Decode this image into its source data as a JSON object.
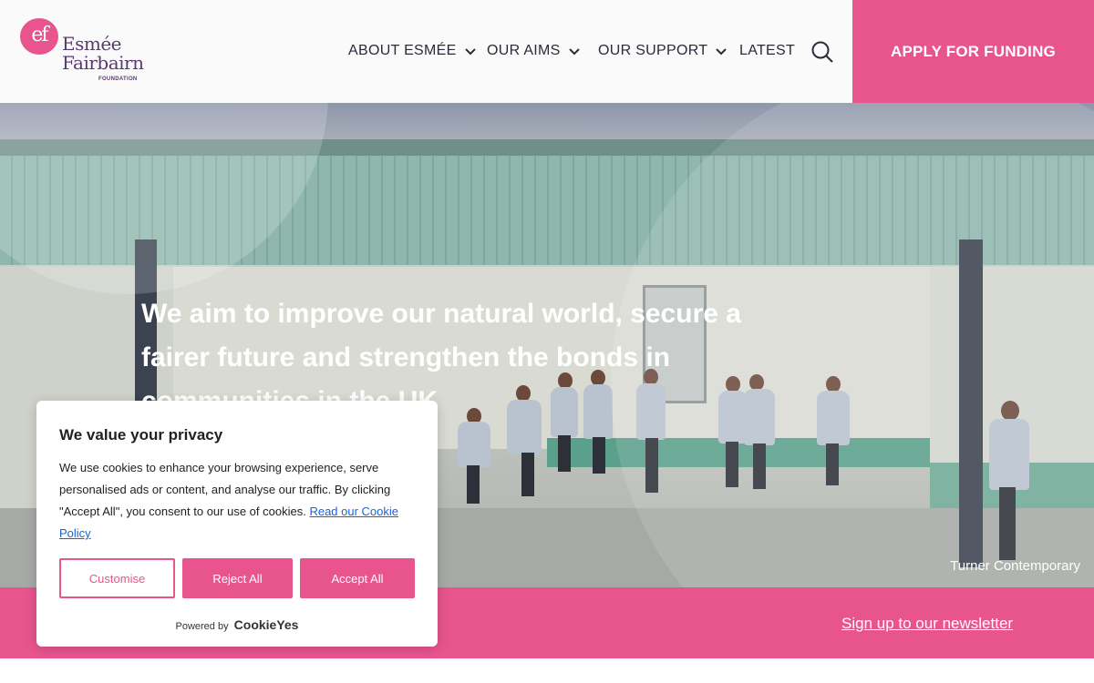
{
  "brand": {
    "logo_mark": "ef",
    "name_line1": "Esmée",
    "name_line2": "Fairbairn",
    "name_sub": "FOUNDATION",
    "accent_color": "#e8548e",
    "text_color": "#5a3a6e"
  },
  "nav": {
    "items": [
      {
        "label": "ABOUT ESMÉE",
        "has_dropdown": true,
        "icon": "chevron-down-icon"
      },
      {
        "label": "OUR AIMS",
        "has_dropdown": true,
        "icon": "chevron-down-icon"
      },
      {
        "label": "OUR SUPPORT",
        "has_dropdown": true,
        "icon": "chevron-down-icon"
      },
      {
        "label": "LATEST",
        "has_dropdown": false
      }
    ],
    "search_icon": "search-icon",
    "cta_label": "APPLY FOR FUNDING"
  },
  "hero": {
    "headline": "We aim to improve our natural world, secure a fairer future and strengthen the bonds in communities in the UK",
    "photo_credit": "Turner Contemporary"
  },
  "strip": {
    "newsletter_link": "Sign up to our newsletter"
  },
  "cookie": {
    "title": "We value your privacy",
    "body": "We use cookies to enhance your browsing experience, serve personalised ads or content, and analyse our traffic. By clicking \"Accept All\", you consent to our use of cookies.",
    "policy_link": "Read our Cookie Policy",
    "buttons": {
      "customise": "Customise",
      "reject": "Reject All",
      "accept": "Accept All"
    },
    "powered_by": "Powered by",
    "powered_brand": "CookieYes"
  }
}
